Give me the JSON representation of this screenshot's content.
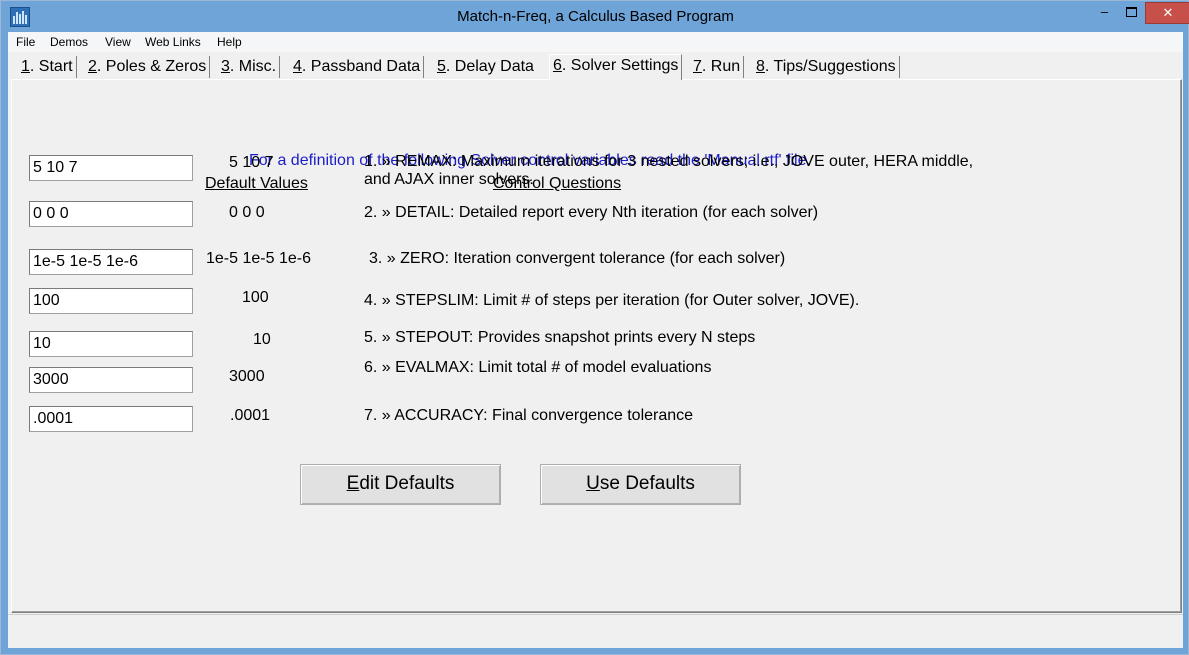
{
  "window": {
    "title": "Match-n-Freq, a Calculus Based Program",
    "controls": {
      "minimize": "–",
      "maximize": "",
      "close": "✕"
    },
    "accent": "#6ea4d8",
    "close_color": "#c7504a"
  },
  "menu": [
    "File",
    "Demos",
    "View",
    "Web Links",
    "Help"
  ],
  "tabs": [
    {
      "num": "1",
      "label": ". Start"
    },
    {
      "num": "2",
      "label": ". Poles & Zeros"
    },
    {
      "num": "3",
      "label": ". Misc."
    },
    {
      "num": "4",
      "label": ". Passband Data"
    },
    {
      "num": "5",
      "label": ". Delay Data"
    },
    {
      "num": "6",
      "label": ". Solver Settings"
    },
    {
      "num": "7",
      "label": ". Run"
    },
    {
      "num": "8",
      "label": ". Tips/Suggestions"
    }
  ],
  "active_tab": "6",
  "panel": {
    "info_text": "For a definition of the following Solver control variables read the 'Manual.rtf' file.",
    "info_color": "#1c1cc8",
    "default_header": "Default Values",
    "questions_header": "Control Questions",
    "rows": [
      {
        "value": "5 10 7",
        "default": "5 10 7",
        "question": "1. » REMAX: Maximum iterations for 3 nested solvers; i.e.,           JOVE outer, HERA middle,",
        "question2": "and AJAX inner solvers."
      },
      {
        "value": "0 0 0",
        "default": "0  0  0",
        "question": "2. »  DETAIL: Detailed report every Nth iteration (for each solver)"
      },
      {
        "value": "1e-5 1e-5 1e-6",
        "default": "1e-5 1e-5 1e-6",
        "question": "3. » ZERO: Iteration convergent tolerance (for each solver)"
      },
      {
        "value": "100",
        "default": "100",
        "question": "4. » STEPSLIM: Limit # of steps per iteration (for Outer solver, JOVE)."
      },
      {
        "value": "10",
        "default": "10",
        "question": "5. » STEPOUT: Provides snapshot prints every N steps"
      },
      {
        "value": "3000",
        "default": "3000",
        "question": "6. » EVALMAX: Limit total # of model evaluations"
      },
      {
        "value": ".0001",
        "default": ".0001",
        "question": "7. » ACCURACY: Final convergence tolerance"
      }
    ],
    "buttons": {
      "edit_hotkey": "E",
      "edit_rest": "dit Defaults",
      "use_hotkey": "U",
      "use_rest": "se Defaults"
    }
  }
}
